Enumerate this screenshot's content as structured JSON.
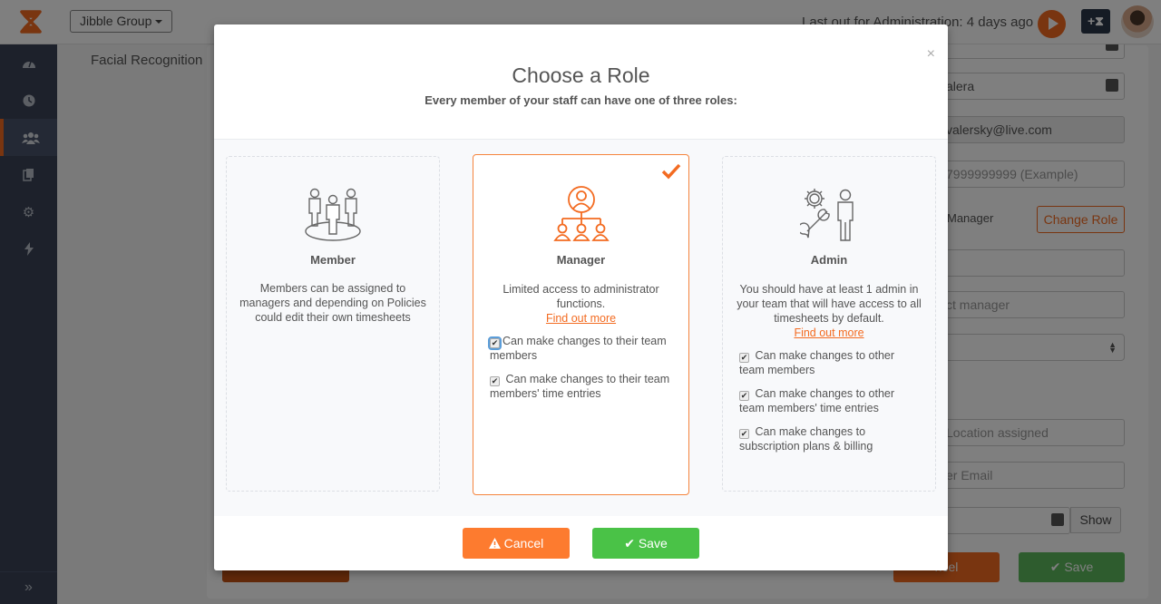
{
  "topbar": {
    "group_selector": "Jibble Group",
    "last_out": "Last out for Administration: 4 days ago",
    "clock_in_icon": "add-time-icon"
  },
  "sidebar": {
    "items": [
      {
        "icon": "dashboard-icon",
        "active": false
      },
      {
        "icon": "clock-icon",
        "active": false
      },
      {
        "icon": "people-icon",
        "active": true
      },
      {
        "icon": "copy-icon",
        "active": false
      },
      {
        "icon": "gear-icon",
        "active": false
      },
      {
        "icon": "bolt-icon",
        "active": false
      }
    ],
    "expand_glyph": "»"
  },
  "background_form": {
    "section_label": "Facial Recognition",
    "last_name_value": "alera",
    "email_value": "valersky@live.com",
    "phone_placeholder": "7999999999 (Example)",
    "role_value": "Manager",
    "change_role_label": "Change Role",
    "manager_placeholder": "ct manager",
    "location_placeholder": "Location assigned",
    "email2_placeholder": "er Email",
    "show_label": "Show",
    "cancel_label": "ncel",
    "save_label": "Save"
  },
  "modal": {
    "title": "Choose a Role",
    "subtitle": "Every member of your staff can have one of three roles:",
    "close_glyph": "×",
    "roles": [
      {
        "name": "Member",
        "description": "Members can be assigned to managers and depending on Policies could edit their own timesheets",
        "selected": false,
        "permissions": []
      },
      {
        "name": "Manager",
        "description": "Limited access to administrator functions.",
        "link": "Find out more",
        "selected": true,
        "permissions": [
          {
            "label": "Can make changes to their team members",
            "checked": true
          },
          {
            "label": "Can make changes to their team members' time entries",
            "checked": true
          }
        ]
      },
      {
        "name": "Admin",
        "description": "You should have at least 1 admin in your team that will have access to all timesheets by default.",
        "link": "Find out more",
        "selected": false,
        "permissions": [
          {
            "label": "Can make changes to other team members",
            "checked": true
          },
          {
            "label": "Can make changes to other team members' time entries",
            "checked": true
          },
          {
            "label": "Can make changes to subscription plans & billing",
            "checked": true
          }
        ]
      }
    ],
    "cancel_label": "Cancel",
    "save_label": "Save"
  },
  "colors": {
    "accent": "#f36b21",
    "cancel": "#fd7b2f",
    "save": "#4ac247",
    "sidebar": "#3a4356"
  }
}
